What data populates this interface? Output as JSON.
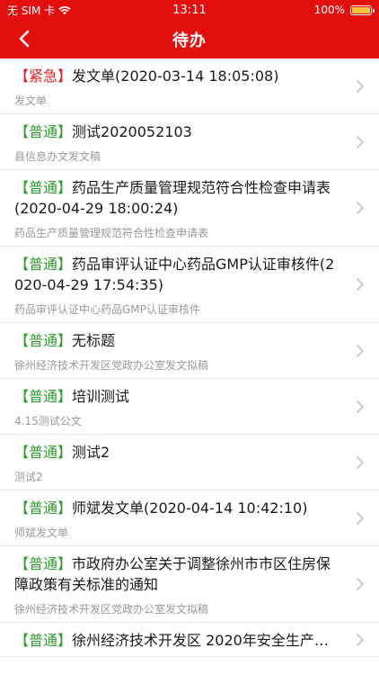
{
  "status_bar": {
    "carrier": "无 SIM 卡",
    "time": "13:11",
    "battery": "100%",
    "battery_level": 1.0
  },
  "nav": {
    "title": "待办"
  },
  "colors": {
    "header": "#e30e0e",
    "urgent_tag": "#e02020",
    "normal_tag": "#2e9b2e"
  },
  "items": [
    {
      "tag": "【紧急】",
      "level": "urgent",
      "title": "发文单(2020-03-14 18:05:08)",
      "subtitle": "发文单"
    },
    {
      "tag": "【普通】",
      "level": "normal",
      "title": "测试2020052103",
      "subtitle": "县信息办文发文稿"
    },
    {
      "tag": "【普通】",
      "level": "normal",
      "title": "药品生产质量管理规范符合性检查申请表(2020-04-29 18:00:24)",
      "subtitle": "药品生产质量管理规范符合性检查申请表"
    },
    {
      "tag": "【普通】",
      "level": "normal",
      "title": "药品审评认证中心药品GMP认证审核件(2020-04-29 17:54:35)",
      "subtitle": "药品审评认证中心药品GMP认证审核件"
    },
    {
      "tag": "【普通】",
      "level": "normal",
      "title": "无标题",
      "subtitle": "徐州经济技术开发区党政办公室发文拟稿"
    },
    {
      "tag": "【普通】",
      "level": "normal",
      "title": "培训测试",
      "subtitle": "4.15测试公文"
    },
    {
      "tag": "【普通】",
      "level": "normal",
      "title": "测试2",
      "subtitle": "测试2"
    },
    {
      "tag": "【普通】",
      "level": "normal",
      "title": "师斌发文单(2020-04-14 10:42:10)",
      "subtitle": "师斌发文单"
    },
    {
      "tag": "【普通】",
      "level": "normal",
      "title": "市政府办公室关于调整徐州市市区住房保障政策有关标准的通知",
      "subtitle": "徐州经济技术开发区党政办公室发文拟稿"
    },
    {
      "tag": "【普通】",
      "level": "normal",
      "title": "徐州经济技术开发区 2020年安全生产…",
      "subtitle": "",
      "clip": true
    }
  ]
}
